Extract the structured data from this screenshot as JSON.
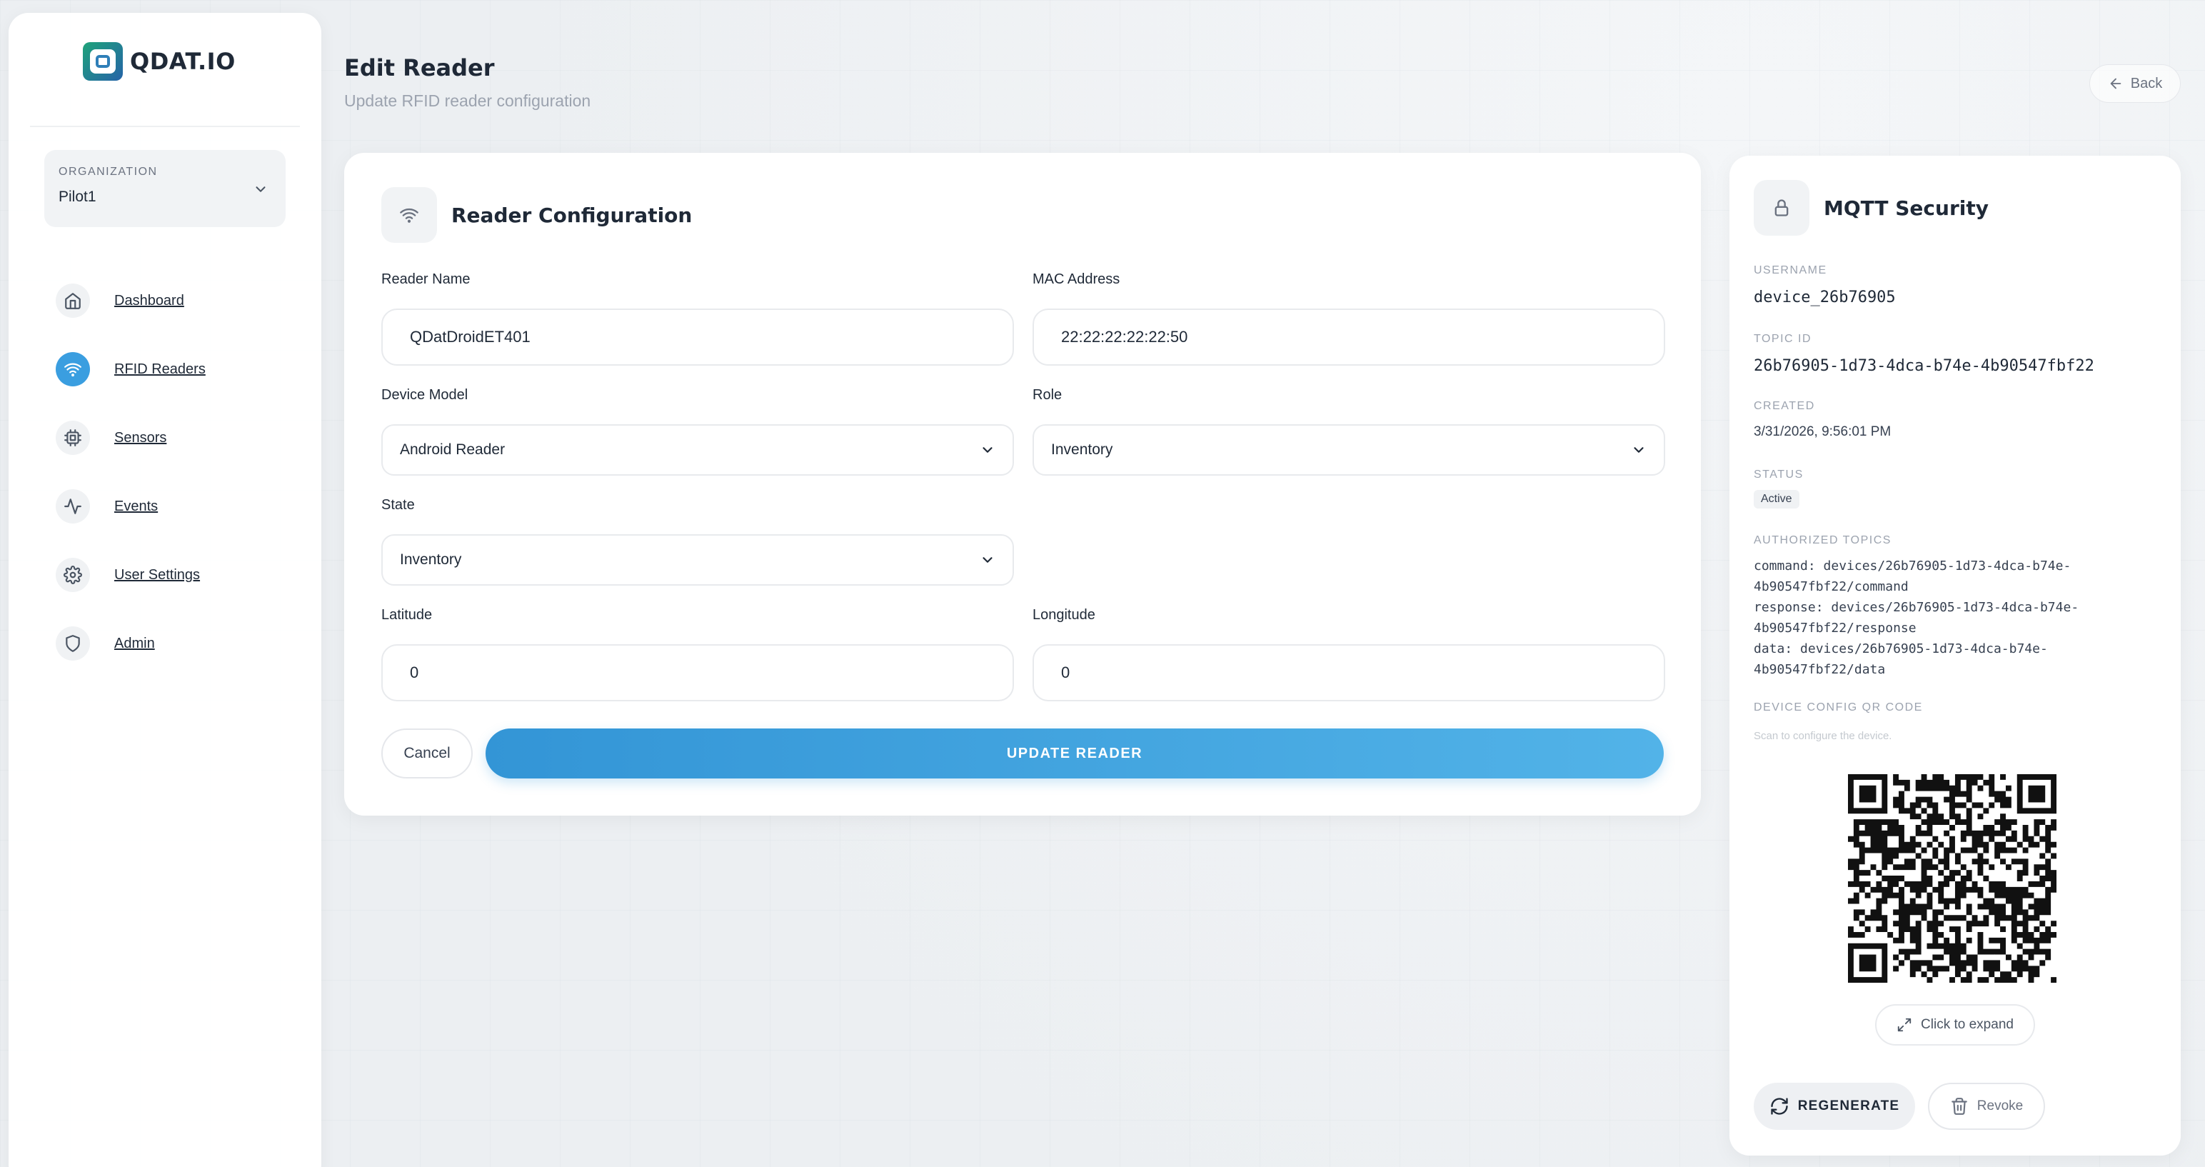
{
  "brand": {
    "name": "QDAT.IO",
    "logo_icon": "qdat-logo-icon",
    "logo_colors": [
      "#1fa37a",
      "#2563a8"
    ]
  },
  "organization": {
    "label": "ORGANIZATION",
    "value": "Pilot1"
  },
  "nav": {
    "active_color": "#3a9ee0",
    "items": [
      {
        "label": "Dashboard",
        "icon": "home-icon",
        "active": false
      },
      {
        "label": "RFID Readers",
        "icon": "wifi-icon",
        "active": true
      },
      {
        "label": "Sensors",
        "icon": "chip-icon",
        "active": false
      },
      {
        "label": "Events",
        "icon": "activity-icon",
        "active": false
      },
      {
        "label": "User Settings",
        "icon": "gear-icon",
        "active": false
      },
      {
        "label": "Admin",
        "icon": "shield-icon",
        "active": false
      }
    ]
  },
  "header": {
    "title": "Edit Reader",
    "subtitle": "Update RFID reader configuration",
    "back_label": "Back"
  },
  "config": {
    "title": "Reader Configuration",
    "fields": {
      "reader_name": {
        "label": "Reader Name",
        "value": "QDatDroidET401"
      },
      "mac_address": {
        "label": "MAC Address",
        "value": "22:22:22:22:22:50"
      },
      "device_model": {
        "label": "Device Model",
        "value": "Android Reader"
      },
      "role": {
        "label": "Role",
        "value": "Inventory"
      },
      "state": {
        "label": "State",
        "value": "Inventory"
      },
      "latitude": {
        "label": "Latitude",
        "value": "0"
      },
      "longitude": {
        "label": "Longitude",
        "value": "0"
      }
    },
    "cancel_label": "Cancel",
    "update_label": "UPDATE READER",
    "accent_color": "#3a9ee0"
  },
  "mqtt": {
    "title": "MQTT Security",
    "username_label": "USERNAME",
    "username": "device_26b76905",
    "topic_id_label": "TOPIC ID",
    "topic_id": "26b76905-1d73-4dca-b74e-4b90547fbf22",
    "created_label": "CREATED",
    "created": "3/31/2026, 9:56:01 PM",
    "status_label": "STATUS",
    "status": "Active",
    "topics_label": "AUTHORIZED TOPICS",
    "topics": [
      "command: devices/26b76905-1d73-4dca-b74e-",
      "4b90547fbf22/command",
      "response: devices/26b76905-1d73-4dca-b74e-",
      "4b90547fbf22/response",
      "data: devices/26b76905-1d73-4dca-b74e-",
      "4b90547fbf22/data"
    ],
    "qr_label": "DEVICE CONFIG QR CODE",
    "qr_hint": "Scan to configure the device.",
    "expand_label": "Click to expand",
    "regenerate_label": "REGENERATE",
    "revoke_label": "Revoke"
  }
}
